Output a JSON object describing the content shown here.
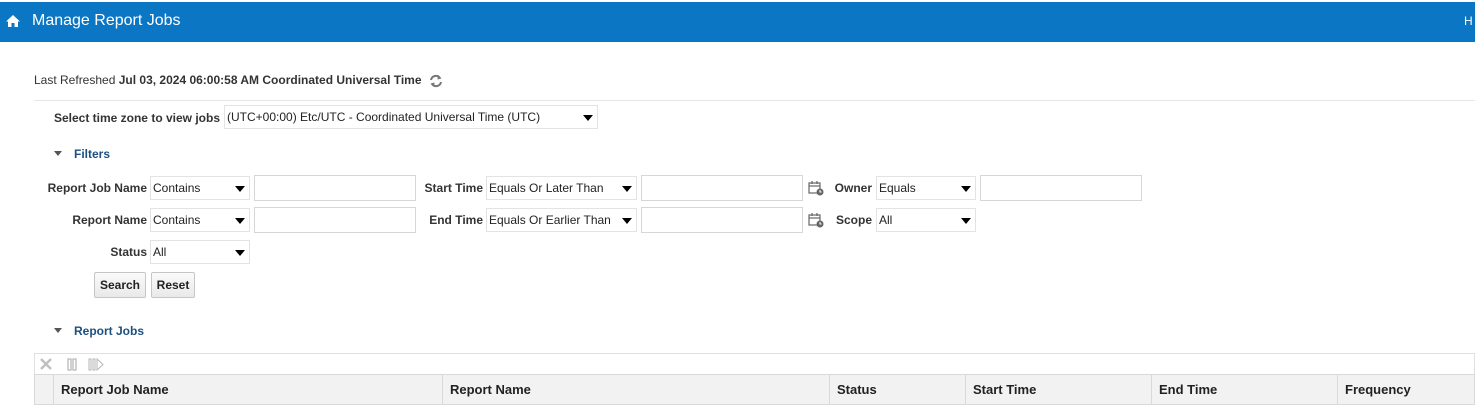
{
  "header": {
    "title": "Manage Report Jobs",
    "right_text": "H",
    "home_icon": "home-icon"
  },
  "refresh": {
    "label": "Last Refreshed",
    "timestamp": "Jul 03, 2024 06:00:58 AM Coordinated Universal Time"
  },
  "timezone": {
    "label": "Select time zone to view jobs",
    "value": "(UTC+00:00) Etc/UTC - Coordinated Universal Time (UTC)"
  },
  "filters": {
    "title": "Filters",
    "report_job_name": {
      "label": "Report Job Name",
      "operator": "Contains"
    },
    "report_name": {
      "label": "Report Name",
      "operator": "Contains"
    },
    "status": {
      "label": "Status",
      "value": "All"
    },
    "start_time": {
      "label": "Start Time",
      "operator": "Equals Or Later Than"
    },
    "end_time": {
      "label": "End Time",
      "operator": "Equals Or Earlier Than"
    },
    "owner": {
      "label": "Owner",
      "operator": "Equals"
    },
    "scope": {
      "label": "Scope",
      "value": "All"
    },
    "search_label": "Search",
    "reset_label": "Reset"
  },
  "report_jobs": {
    "title": "Report Jobs",
    "columns": [
      "Report Job Name",
      "Report Name",
      "Status",
      "Start Time",
      "End Time",
      "Frequency"
    ]
  },
  "colors": {
    "header_bg": "#0a76c4",
    "section_title": "#1d4f80"
  }
}
